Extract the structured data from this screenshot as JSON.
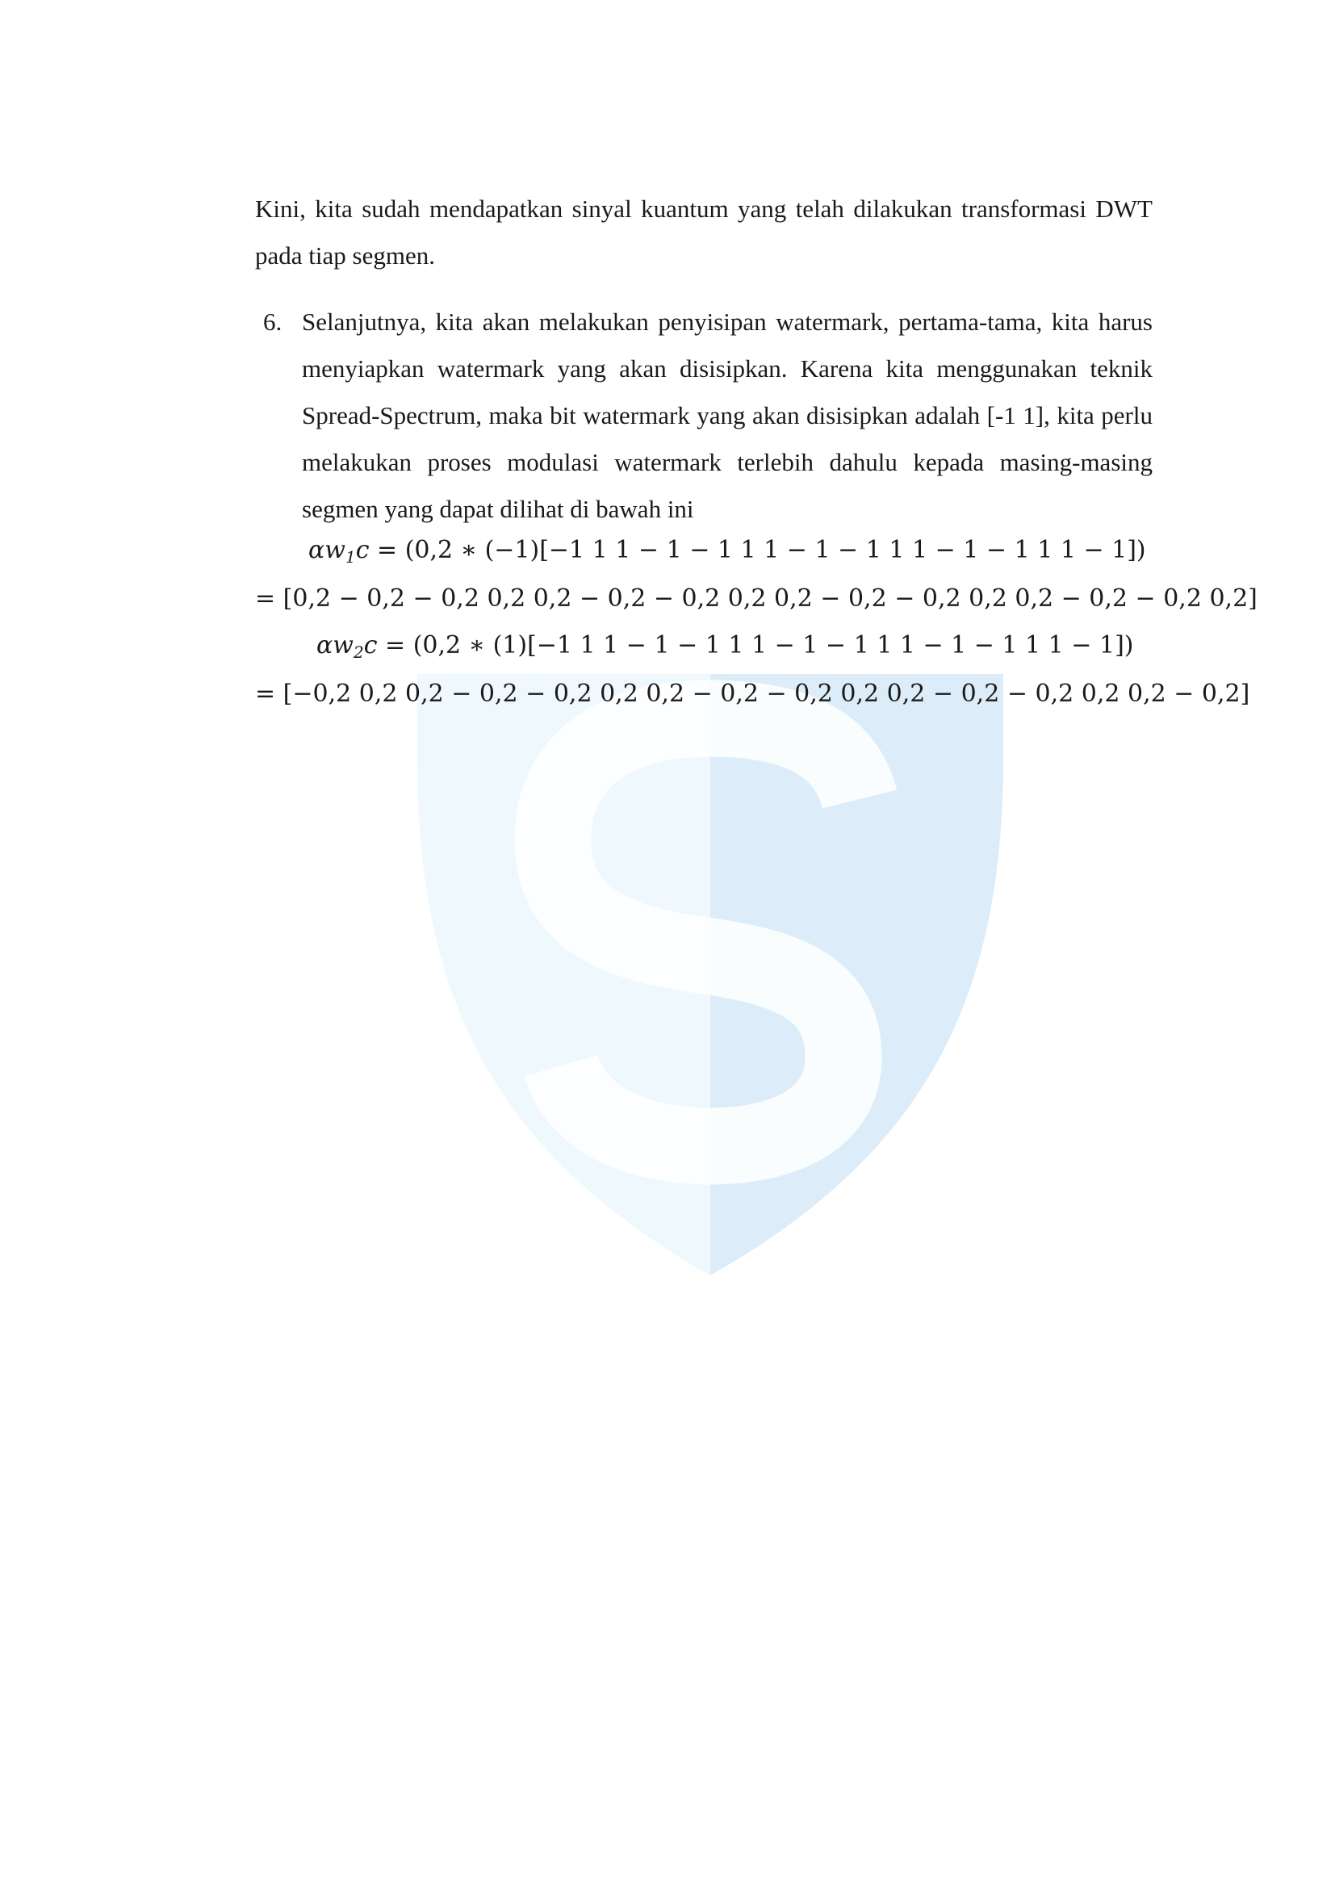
{
  "paragraph_intro": "Kini, kita sudah mendapatkan sinyal kuantum yang telah dilakukan transformasi DWT pada tiap segmen.",
  "list_item": {
    "number": "6.",
    "text": "Selanjutnya, kita akan melakukan penyisipan watermark, pertama-tama, kita harus menyiapkan watermark yang akan disisipkan. Karena kita menggunakan teknik Spread-Spectrum, maka bit watermark yang akan disisipkan adalah [-1 1], kita perlu melakukan proses modulasi watermark terlebih dahulu kepada masing-masing segmen yang dapat dilihat di bawah ini"
  },
  "equations": [
    {
      "lhs_alpha": "α",
      "lhs_w": "w",
      "lhs_sub": "1",
      "lhs_c": "c",
      "rhs": " = (0,2 ∗ (−1)[−1 1 1 − 1 − 1 1 1 − 1 − 1 1 1 − 1 − 1 1 1 − 1])",
      "result": "=  [0,2  − 0,2  − 0,2 0,2 0,2  − 0,2  − 0,2 0,2 0,2  − 0,2  − 0,2 0,2 0,2  − 0,2  − 0,2 0,2]"
    },
    {
      "lhs_alpha": "α",
      "lhs_w": "w",
      "lhs_sub": "2",
      "lhs_c": "c",
      "rhs": " = (0,2 ∗ (1)[−1 1 1 − 1 − 1 1 1 − 1 − 1 1 1 − 1 − 1 1 1 − 1])",
      "result": "=  [−0,2 0,2 0,2  − 0,2  − 0,2 0,2 0,2  − 0,2  − 0,2 0,2 0,2  − 0,2  − 0,2 0,2 0,2  − 0,2]"
    }
  ],
  "colors": {
    "text": "#1a1a1a",
    "watermark_left": "#eef8fd",
    "watermark_right": "#dcedf9"
  },
  "icons": {
    "watermark": "s-shield-logo"
  }
}
